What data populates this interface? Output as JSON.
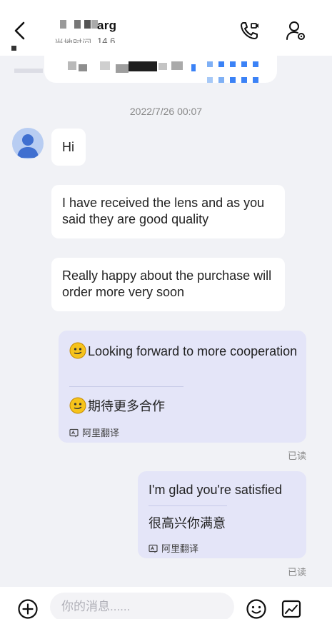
{
  "header": {
    "contact_name": "arg",
    "local_time": "14 6",
    "local_time_prefix": "当地时间"
  },
  "chat": {
    "timestamp": "2022/7/26 00:07",
    "messages": [
      {
        "direction": "in",
        "text": "Hi"
      },
      {
        "direction": "in",
        "text": "I have received the lens and as you said they are good quality"
      },
      {
        "direction": "in",
        "text": "Really happy about the purchase will order more very soon"
      },
      {
        "direction": "out",
        "text": "Looking forward to more cooperation",
        "translation": "期待更多合作",
        "translator_label": "阿里翻译",
        "status": "已读"
      },
      {
        "direction": "out",
        "text": "I'm glad you're satisfied",
        "translation": "很高兴你满意",
        "translator_label": "阿里翻译",
        "status": "已读"
      }
    ]
  },
  "input": {
    "placeholder": "你的消息......"
  },
  "icons": {
    "back": "chevron-left-icon",
    "call": "phone-video-icon",
    "profile": "user-settings-icon",
    "add": "plus-circle-icon",
    "emoji": "smile-icon",
    "image": "image-icon",
    "translate": "translate-icon",
    "avatar": "default-user-avatar"
  },
  "colors": {
    "background": "#f1f2f6",
    "incoming_bubble": "#ffffff",
    "outgoing_bubble": "#e4e5f8",
    "avatar": "#4a7fe0",
    "accent_blue": "#3b82f6"
  }
}
